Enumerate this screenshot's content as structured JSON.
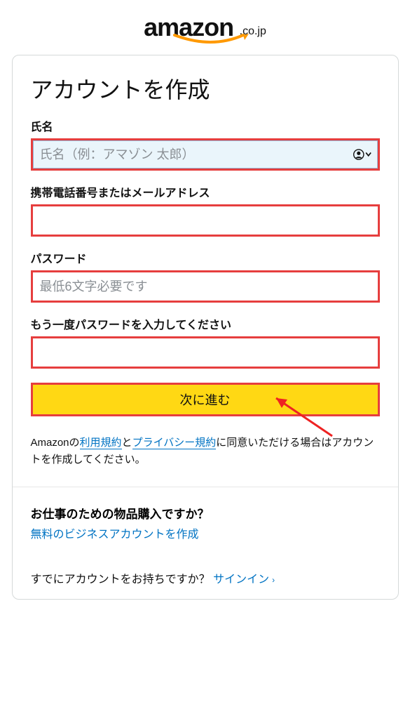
{
  "logo": {
    "brand": "amazon",
    "suffix": ".co.jp"
  },
  "title": "アカウントを作成",
  "fields": {
    "name": {
      "label": "氏名",
      "placeholder": "氏名（例：アマゾン 太郎）"
    },
    "contact": {
      "label": "携帯電話番号またはメールアドレス",
      "placeholder": ""
    },
    "password": {
      "label": "パスワード",
      "placeholder": "最低6文字必要です"
    },
    "password2": {
      "label": "もう一度パスワードを入力してください",
      "placeholder": ""
    }
  },
  "submit_label": "次に進む",
  "terms": {
    "prefix": "Amazonの",
    "link1": "利用規約",
    "mid": "と",
    "link2": "プライバシー規約",
    "suffix": "に同意いただける場合はアカウントを作成してください。"
  },
  "business": {
    "title": "お仕事のための物品購入ですか？",
    "link": "無料のビジネスアカウントを作成"
  },
  "signin": {
    "prompt": "すでにアカウントをお持ちですか？",
    "link": "サインイン"
  }
}
